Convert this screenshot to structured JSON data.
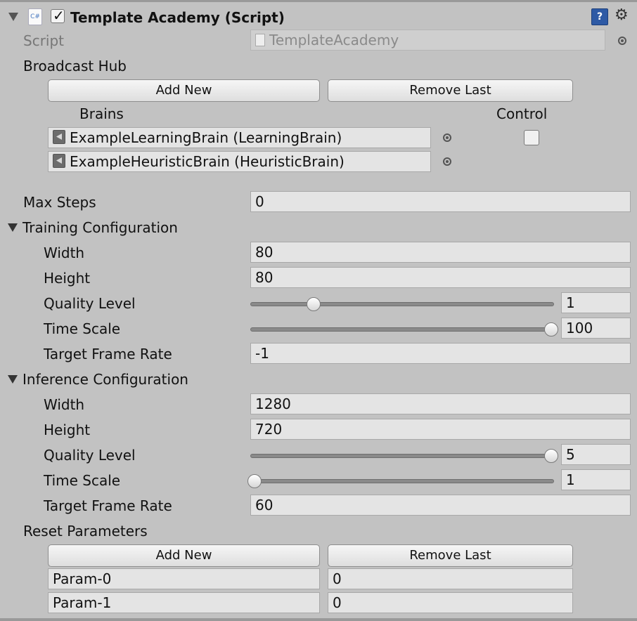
{
  "component": {
    "title": "Template Academy (Script)",
    "enabled": true,
    "script_icon_text": "C#",
    "help_glyph": "?",
    "gear_glyph": "⚙"
  },
  "script": {
    "label": "Script",
    "value": "TemplateAcademy"
  },
  "broadcast_hub": {
    "label": "Broadcast Hub",
    "add_label": "Add New",
    "remove_label": "Remove Last",
    "brains_header": "Brains",
    "control_header": "Control",
    "brains": [
      {
        "name": "ExampleLearningBrain (LearningBrain)",
        "control": false,
        "has_control": true
      },
      {
        "name": "ExampleHeuristicBrain (HeuristicBrain)",
        "has_control": false
      }
    ]
  },
  "max_steps": {
    "label": "Max Steps",
    "value": "0"
  },
  "training": {
    "label": "Training Configuration",
    "width": {
      "label": "Width",
      "value": "80"
    },
    "height": {
      "label": "Height",
      "value": "80"
    },
    "quality": {
      "label": "Quality Level",
      "value": "1",
      "min": 0,
      "max": 5
    },
    "time_scale": {
      "label": "Time Scale",
      "value": "100",
      "min": 0,
      "max": 100
    },
    "target_frame_rate": {
      "label": "Target Frame Rate",
      "value": "-1"
    }
  },
  "inference": {
    "label": "Inference Configuration",
    "width": {
      "label": "Width",
      "value": "1280"
    },
    "height": {
      "label": "Height",
      "value": "720"
    },
    "quality": {
      "label": "Quality Level",
      "value": "5",
      "min": 0,
      "max": 5
    },
    "time_scale": {
      "label": "Time Scale",
      "value": "1",
      "min": 1,
      "max": 100
    },
    "target_frame_rate": {
      "label": "Target Frame Rate",
      "value": "60"
    }
  },
  "reset_parameters": {
    "label": "Reset Parameters",
    "add_label": "Add New",
    "remove_label": "Remove Last",
    "params": [
      {
        "key": "Param-0",
        "value": "0"
      },
      {
        "key": "Param-1",
        "value": "0"
      }
    ]
  },
  "colors": {
    "panel_bg": "#c2c2c2",
    "field_bg": "#e4e4e4",
    "help_blue": "#2e5aa5"
  }
}
